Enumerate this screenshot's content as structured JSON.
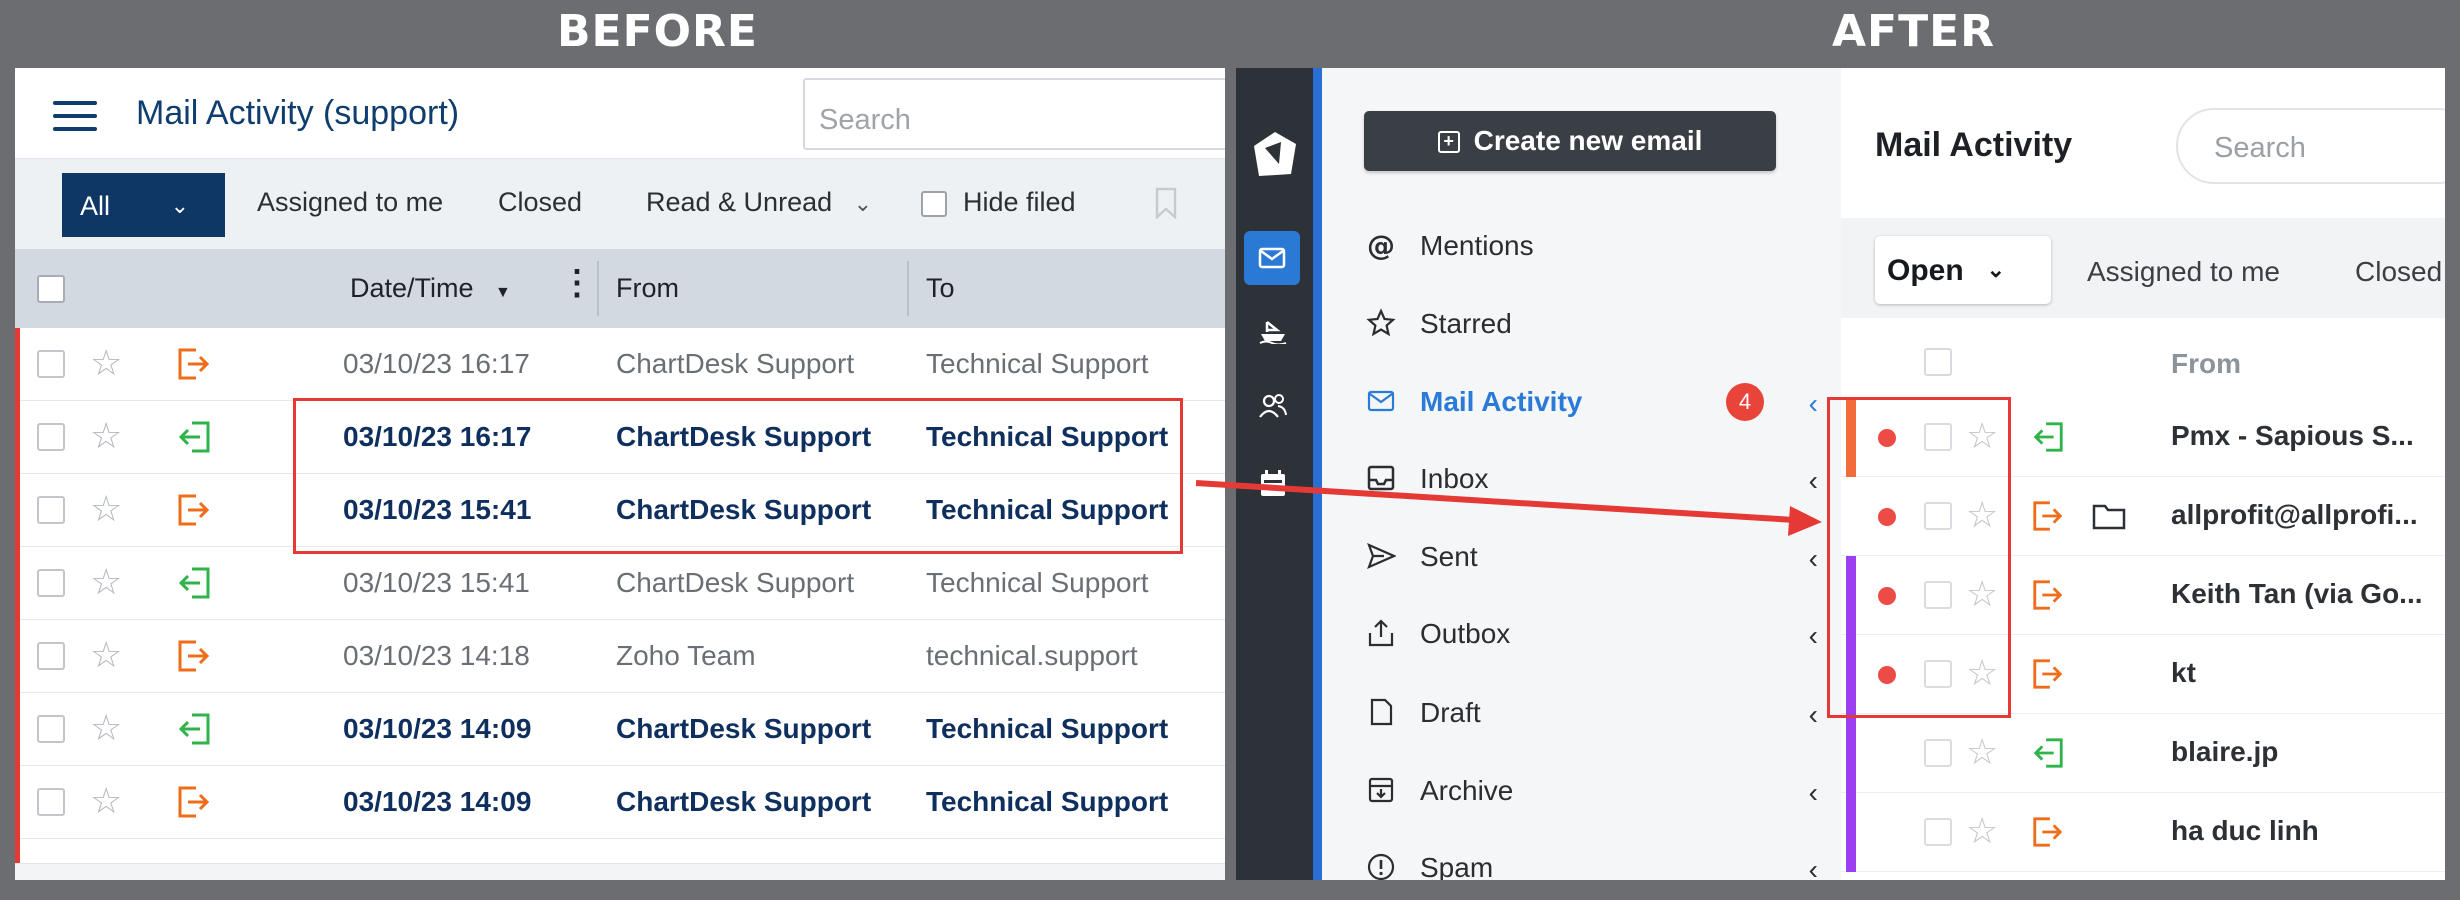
{
  "headings": {
    "before": "BEFORE",
    "after": "AFTER"
  },
  "before": {
    "title": "Mail Activity (support)",
    "search_placeholder": "Search",
    "filters": {
      "all": "All",
      "assigned": "Assigned to me",
      "closed": "Closed",
      "read_unread": "Read & Unread",
      "hide_filed": "Hide filed"
    },
    "columns": {
      "datetime": "Date/Time",
      "from": "From",
      "to": "To"
    },
    "rows": [
      {
        "datetime": "03/10/23 16:17",
        "from": "ChartDesk Support",
        "to": "Technical Support",
        "direction": "outgoing",
        "bold": false
      },
      {
        "datetime": "03/10/23 16:17",
        "from": "ChartDesk Support",
        "to": "Technical Support",
        "direction": "incoming",
        "bold": true
      },
      {
        "datetime": "03/10/23 15:41",
        "from": "ChartDesk Support",
        "to": "Technical Support",
        "direction": "outgoing",
        "bold": true
      },
      {
        "datetime": "03/10/23 15:41",
        "from": "ChartDesk Support",
        "to": "Technical Support",
        "direction": "incoming",
        "bold": false
      },
      {
        "datetime": "03/10/23 14:18",
        "from": "Zoho Team",
        "to": "technical.support",
        "direction": "outgoing",
        "bold": false
      },
      {
        "datetime": "03/10/23 14:09",
        "from": "ChartDesk Support",
        "to": "Technical Support",
        "direction": "incoming",
        "bold": true
      },
      {
        "datetime": "03/10/23 14:09",
        "from": "ChartDesk Support",
        "to": "Technical Support",
        "direction": "outgoing",
        "bold": true
      }
    ]
  },
  "after": {
    "create_button": "Create new email",
    "nav": [
      {
        "label": "Mentions",
        "icon": "at-icon",
        "chevron": false,
        "active": false
      },
      {
        "label": "Starred",
        "icon": "star-icon",
        "chevron": false,
        "active": false
      },
      {
        "label": "Mail Activity",
        "icon": "envelope-icon",
        "chevron": true,
        "active": true,
        "badge": "4"
      },
      {
        "label": "Inbox",
        "icon": "inbox-icon",
        "chevron": true,
        "active": false
      },
      {
        "label": "Sent",
        "icon": "send-icon",
        "chevron": true,
        "active": false
      },
      {
        "label": "Outbox",
        "icon": "outbox-icon",
        "chevron": true,
        "active": false
      },
      {
        "label": "Draft",
        "icon": "draft-icon",
        "chevron": true,
        "active": false
      },
      {
        "label": "Archive",
        "icon": "archive-icon",
        "chevron": true,
        "active": false
      },
      {
        "label": "Spam",
        "icon": "spam-icon",
        "chevron": true,
        "active": false
      }
    ],
    "title": "Mail Activity",
    "search_placeholder": "Search",
    "filters": {
      "open": "Open",
      "assigned": "Assigned to me",
      "closed": "Closed"
    },
    "columns": {
      "from": "From"
    },
    "rows": [
      {
        "sender": "Pmx - Sapious S...",
        "direction": "incoming",
        "unread": true,
        "bar": "#f26b3a",
        "folder": false
      },
      {
        "sender": "allprofit@allprofi...",
        "direction": "outgoing",
        "unread": true,
        "bar": "",
        "folder": true
      },
      {
        "sender": "Keith Tan (via Go...",
        "direction": "outgoing",
        "unread": true,
        "bar": "#9b3ff0",
        "folder": false
      },
      {
        "sender": "kt",
        "direction": "outgoing",
        "unread": true,
        "bar": "#9b3ff0",
        "folder": false
      },
      {
        "sender": "blaire.jp",
        "direction": "incoming",
        "unread": false,
        "bar": "#9b3ff0",
        "folder": false
      },
      {
        "sender": "ha duc linh",
        "direction": "outgoing",
        "unread": false,
        "bar": "#9b3ff0",
        "folder": false
      }
    ]
  },
  "colors": {
    "highlight": "#e53935",
    "incoming": "#2fb34a",
    "outgoing": "#ef6c1a",
    "brand_blue": "#2a7bd8"
  }
}
